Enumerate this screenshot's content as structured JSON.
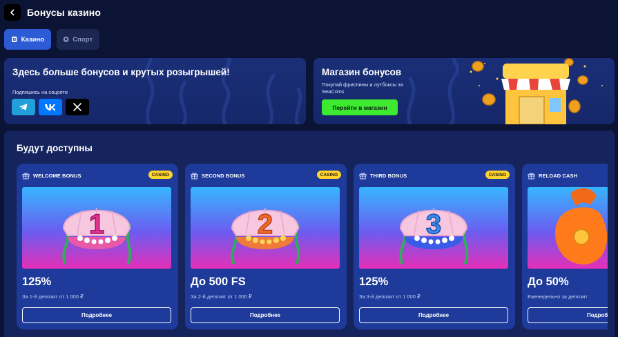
{
  "header": {
    "title": "Бонусы казино"
  },
  "tabs": [
    {
      "label": "Казино",
      "active": true,
      "icon": "casino-icon"
    },
    {
      "label": "Спорт",
      "active": false,
      "icon": "ball-icon"
    }
  ],
  "social_banner": {
    "heading": "Здесь больше бонусов и крутых розыгрышей!",
    "subscribe_label": "Подпишись на соцсети",
    "networks": [
      {
        "name": "telegram",
        "icon": "telegram-icon",
        "text": ""
      },
      {
        "name": "vk",
        "icon": "vk-icon",
        "text": ""
      },
      {
        "name": "x",
        "icon": "x-icon",
        "text": ""
      }
    ]
  },
  "shop_banner": {
    "heading": "Магазин бонусов",
    "subtitle": "Покупай фриспины и лутбоксы за SeaCoins",
    "button_label": "Перейти в магазин"
  },
  "section": {
    "title": "Будут доступны"
  },
  "bonuses": [
    {
      "title": "WELCOME BONUS",
      "badge": "CASINO",
      "number": "1",
      "value": "125%",
      "description": "За 1-й депозит от 1 000 ₽",
      "button": "Подробнее"
    },
    {
      "title": "SECOND BONUS",
      "badge": "CASINO",
      "number": "2",
      "value": "До 500 FS",
      "description": "За 2-й депозит от 1 000 ₽",
      "button": "Подробнее"
    },
    {
      "title": "THIRD BONUS",
      "badge": "CASINO",
      "number": "3",
      "value": "125%",
      "description": "За 3-й депозит от 1 000 ₽",
      "button": "Подробнее"
    },
    {
      "title": "RELOAD CASH",
      "badge": "",
      "number": "",
      "value": "До 50%",
      "description": "Еженедельно за депозит",
      "button": "Подробнее"
    }
  ],
  "colors": {
    "background": "#0b1434",
    "accent_blue": "#2d5bd6",
    "shop_button": "#3dea2f",
    "badge": "#ffd32b",
    "card": "#1e3a9a"
  }
}
